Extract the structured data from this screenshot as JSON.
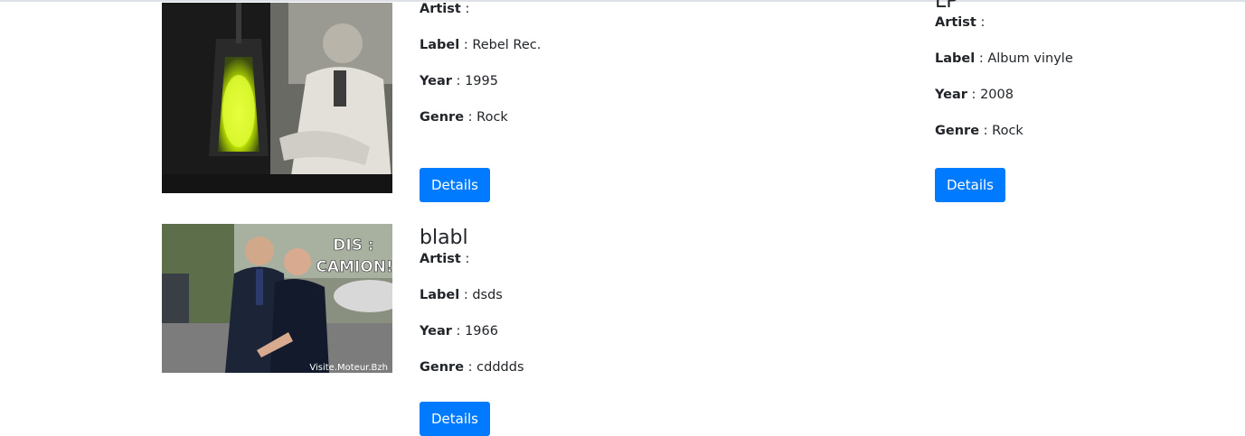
{
  "labels": {
    "artist": "Artist",
    "label": "Label",
    "year": "Year",
    "genre": "Genre",
    "separator": " : "
  },
  "albums": [
    {
      "title": "",
      "artist": "",
      "label": "Rebel Rec.",
      "year": "1995",
      "genre": "Rock",
      "details_label": "Details",
      "cover": "vintage-lab-photo-with-glowing-green-lamp"
    },
    {
      "title": "LP",
      "artist": "",
      "label": "Album vinyle",
      "year": "2008",
      "genre": "Rock",
      "details_label": "Details",
      "cover": "none"
    },
    {
      "title": "blabl",
      "artist": "",
      "label": "dsds",
      "year": "1966",
      "genre": "cdddds",
      "details_label": "Details",
      "cover": "two-men-in-suits-photo",
      "cover_caption": "DIS :\nCAMION!",
      "cover_watermark": "Visite.Moteur.Bzh"
    }
  ],
  "colors": {
    "primary": "#007bff",
    "text": "#212529",
    "glow": "#c8f000"
  }
}
